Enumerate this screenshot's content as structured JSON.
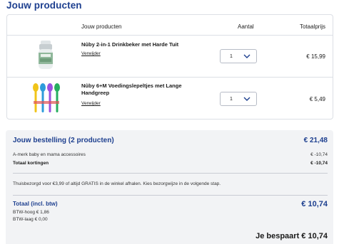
{
  "page": {
    "title": "Jouw producten"
  },
  "table": {
    "headers": {
      "product": "Jouw producten",
      "quantity": "Aantal",
      "total": "Totaalprijs"
    },
    "rows": [
      {
        "name": "Nûby 2-in-1 Drinkbeker met Harde Tuit",
        "remove": "Verwijder",
        "qty": "1",
        "price": "€ 15,99",
        "image": "sippy-cup-image"
      },
      {
        "name": "Nûby 6+M Voedingslepeltjes met Lange Handgreep",
        "remove": "Verwijder",
        "qty": "1",
        "price": "€ 5,49",
        "image": "feeding-spoons-image"
      }
    ]
  },
  "summary": {
    "title": "Jouw bestelling (2 producten)",
    "total": "€ 21,48",
    "discount_label": "A-merk baby en mama accessoires",
    "discount_value": "€ -10,74",
    "total_discount_label": "Totaal kortingen",
    "total_discount_value": "€ -10,74",
    "delivery_note": "Thuisbezorgd voor €3,99 of altijd GRATIS in de winkel afhalen. Kies bezorgwijze in de volgende stap.",
    "grand_label": "Totaal (incl. btw)",
    "grand_value": "€ 10,74",
    "btw_high": "BTW-hoog € 1,86",
    "btw_low": "BTW-laag € 0,00",
    "saved": "Je bespaart € 10,74"
  },
  "colors": {
    "accent": "#1d3f8f",
    "summary_bg": "#f2f3f5",
    "border": "#dcdfe5"
  }
}
